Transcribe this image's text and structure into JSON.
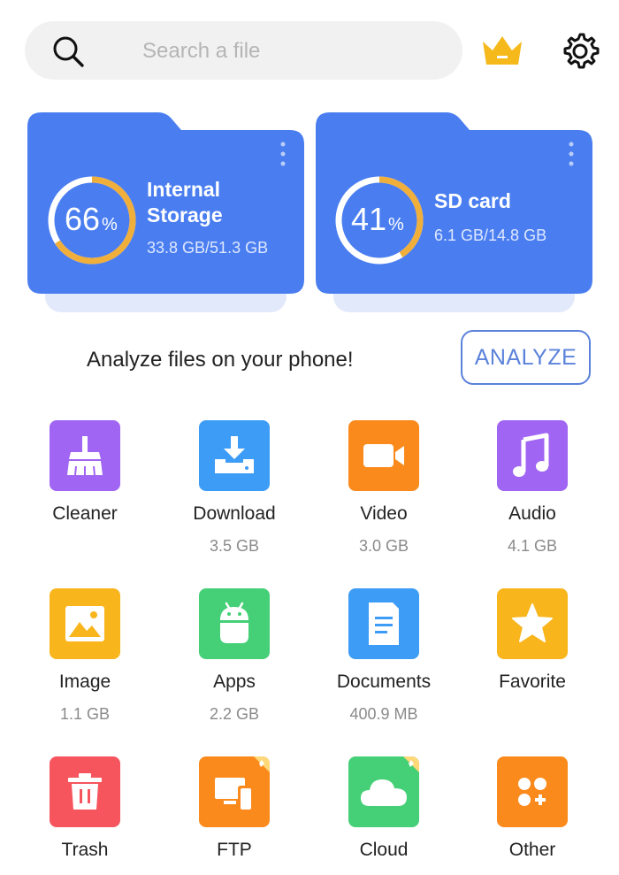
{
  "search": {
    "placeholder": "Search a file"
  },
  "storage": {
    "internal": {
      "percent": "66",
      "percent_sign": "%",
      "name_line1": "Internal",
      "name_line2": "Storage",
      "usage": "33.8 GB/51.3 GB",
      "fraction": 0.66
    },
    "sd": {
      "percent": "41",
      "percent_sign": "%",
      "name": "SD card",
      "usage": "6.1 GB/14.8 GB",
      "fraction": 0.41
    }
  },
  "analyze": {
    "text": "Analyze files on your phone!",
    "button": "ANALYZE"
  },
  "colors": {
    "card_blue": "#4a7ef0",
    "ring_orange": "#f0ae3b",
    "crown_gold": "#f6b91c",
    "accent_blue": "#5b82db"
  },
  "categories": [
    {
      "label": "Cleaner",
      "size": "",
      "icon": "broom-icon",
      "color": "#a065f2"
    },
    {
      "label": "Download",
      "size": "3.5 GB",
      "icon": "download-icon",
      "color": "#3d9cf5"
    },
    {
      "label": "Video",
      "size": "3.0 GB",
      "icon": "video-camera-icon",
      "color": "#fb8a1c"
    },
    {
      "label": "Audio",
      "size": "4.1 GB",
      "icon": "music-note-icon",
      "color": "#a065f2"
    },
    {
      "label": "Image",
      "size": "1.1 GB",
      "icon": "image-icon",
      "color": "#f8b51c"
    },
    {
      "label": "Apps",
      "size": "2.2 GB",
      "icon": "android-icon",
      "color": "#45d077"
    },
    {
      "label": "Documents",
      "size": "400.9 MB",
      "icon": "document-icon",
      "color": "#3d9cf5"
    },
    {
      "label": "Favorite",
      "size": "",
      "icon": "star-icon",
      "color": "#f8b51c"
    },
    {
      "label": "Trash",
      "size": "",
      "icon": "trash-icon",
      "color": "#f6555d"
    },
    {
      "label": "FTP",
      "size": "",
      "icon": "devices-icon",
      "color": "#fb8a1c"
    },
    {
      "label": "Cloud",
      "size": "",
      "icon": "cloud-icon",
      "color": "#45d077"
    },
    {
      "label": "Other",
      "size": "",
      "icon": "apps-grid-icon",
      "color": "#fb8a1c"
    }
  ]
}
